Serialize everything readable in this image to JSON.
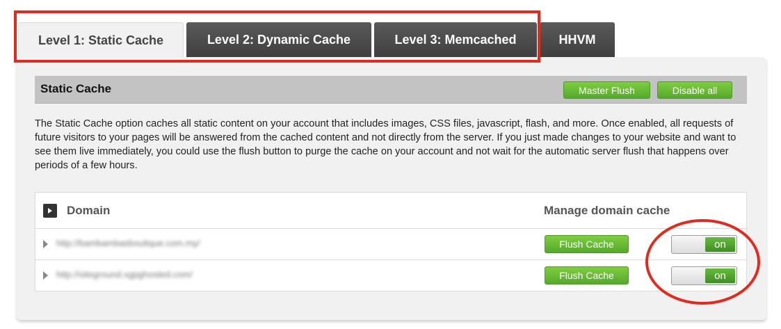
{
  "tabs": [
    {
      "label": "Level 1: Static Cache",
      "active": true
    },
    {
      "label": "Level 2: Dynamic Cache",
      "active": false
    },
    {
      "label": "Level 3: Memcached",
      "active": false
    },
    {
      "label": "HHVM",
      "active": false
    }
  ],
  "section": {
    "title": "Static Cache",
    "master_flush_label": "Master Flush",
    "disable_all_label": "Disable all"
  },
  "description": "The Static Cache option caches all static content on your account that includes images, CSS files, javascript, flash, and more. Once enabled, all requests of future visitors to your pages will be answered from the cached content and not directly from the server. If you just made changes to your website and want to see them live immediately, you could use the flush button to purge the cache on your account and not wait for the automatic server flush that happens over periods of a few hours.",
  "table": {
    "col_domain": "Domain",
    "col_manage": "Manage domain cache",
    "rows": [
      {
        "domain": "http://bambambasboutique.com.my/",
        "flush_label": "Flush Cache",
        "toggle_label": "on"
      },
      {
        "domain": "http://siteground.sgpghosted.com/",
        "flush_label": "Flush Cache",
        "toggle_label": "on"
      }
    ]
  },
  "colors": {
    "annotation": "#e02b20",
    "accent_green": "#5fb52f",
    "tab_inactive": "#4d4d4d"
  }
}
